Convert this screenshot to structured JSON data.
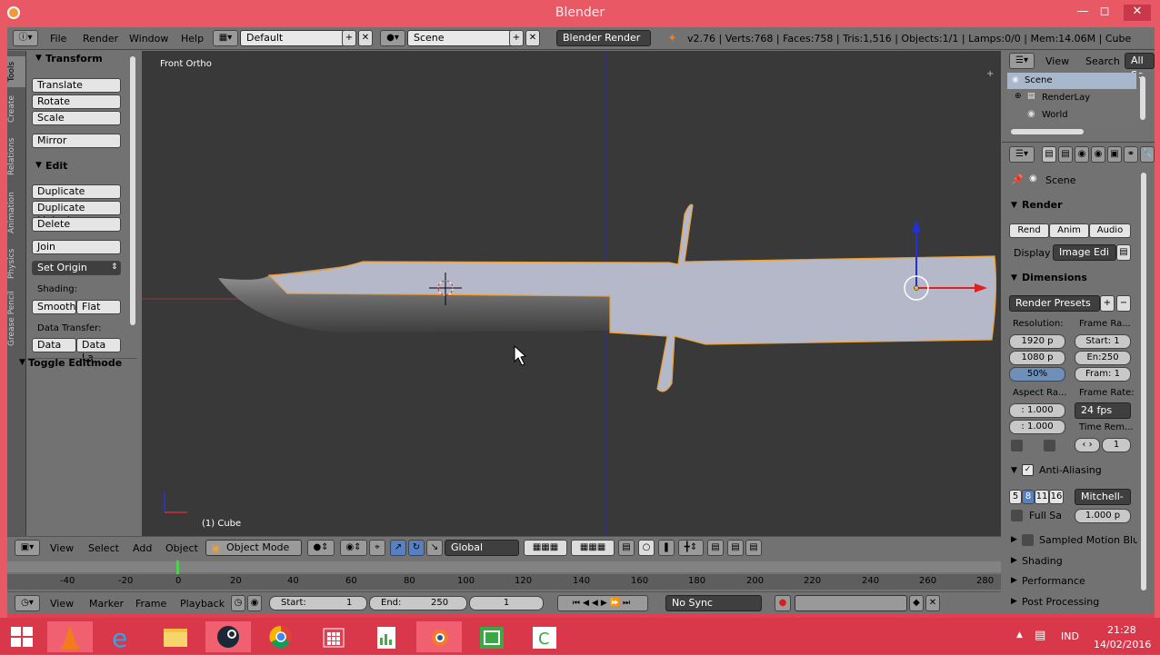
{
  "window": {
    "title": "Blender"
  },
  "info_header": {
    "menus": [
      "File",
      "Render",
      "Window",
      "Help"
    ],
    "layout": "Default",
    "scene": "Scene",
    "engine": "Blender Render",
    "stats": "v2.76 | Verts:768 | Faces:758 | Tris:1,516 | Objects:1/1 | Lamps:0/0 | Mem:14.06M | Cube"
  },
  "tool_tabs": [
    "Tools",
    "Create",
    "Relations",
    "Animation",
    "Physics",
    "Grease Pencil"
  ],
  "toolshelf": {
    "transform_title": "Transform",
    "translate": "Translate",
    "rotate": "Rotate",
    "scale": "Scale",
    "mirror": "Mirror",
    "edit_title": "Edit",
    "duplicate": "Duplicate",
    "duplicate_linked": "Duplicate Linked",
    "delete": "Delete",
    "join": "Join",
    "set_origin": "Set Origin",
    "shading_label": "Shading:",
    "smooth": "Smooth",
    "flat": "Flat",
    "data_transfer_label": "Data Transfer:",
    "data": "Data",
    "data_la": "Data La",
    "toggle_editmode": "Toggle Editmode"
  },
  "viewport": {
    "view_name": "Front Ortho",
    "object_label": "(1) Cube"
  },
  "viewport_header": {
    "menus": [
      "View",
      "Select",
      "Add",
      "Object"
    ],
    "mode": "Object Mode",
    "orientation": "Global"
  },
  "timeline": {
    "ticks": [
      "-40",
      "-20",
      "0",
      "20",
      "40",
      "60",
      "80",
      "100",
      "120",
      "140",
      "160",
      "180",
      "200",
      "220",
      "240",
      "260",
      "280"
    ],
    "menus": [
      "View",
      "Marker",
      "Frame",
      "Playback"
    ],
    "start_label": "Start:",
    "start_value": "1",
    "end_label": "End:",
    "end_value": "250",
    "current_frame": "1",
    "sync": "No Sync"
  },
  "outliner": {
    "header": [
      "View",
      "Search",
      "All Sc"
    ],
    "items": [
      "Scene",
      "RenderLay",
      "World"
    ]
  },
  "properties": {
    "context": "Scene",
    "render_title": "Render",
    "render_btns": [
      "Rend",
      "Anim",
      "Audio"
    ],
    "display_label": "Display",
    "display_value": "Image Edi",
    "dimensions_title": "Dimensions",
    "render_presets": "Render Presets",
    "resolution_label": "Resolution:",
    "frame_range_label": "Frame Ra...",
    "res_x": "1920 p",
    "res_y": "1080 p",
    "res_pct": "50%",
    "start": "Start: 1",
    "end": "En:250",
    "frame": "Fram: 1",
    "aspect_label": "Aspect Ra...",
    "frame_rate_label": "Frame Rate:",
    "aspect_x": ": 1.000",
    "aspect_y": ": 1.000",
    "fps": "24 fps",
    "time_rem_label": "Time Rem...",
    "time_rem_value": "1",
    "aa_title": "Anti-Aliasing",
    "aa_samples": [
      "5",
      "8",
      "11",
      "16"
    ],
    "aa_filter": "Mitchell-",
    "full_sample": "Full Sa",
    "filter_size": "1.000 p",
    "motion_blur": "Sampled Motion Blur",
    "shading": "Shading",
    "performance": "Performance",
    "post_processing": "Post Processing"
  },
  "taskbar": {
    "language": "IND",
    "time": "21:28",
    "date": "14/02/2016"
  }
}
